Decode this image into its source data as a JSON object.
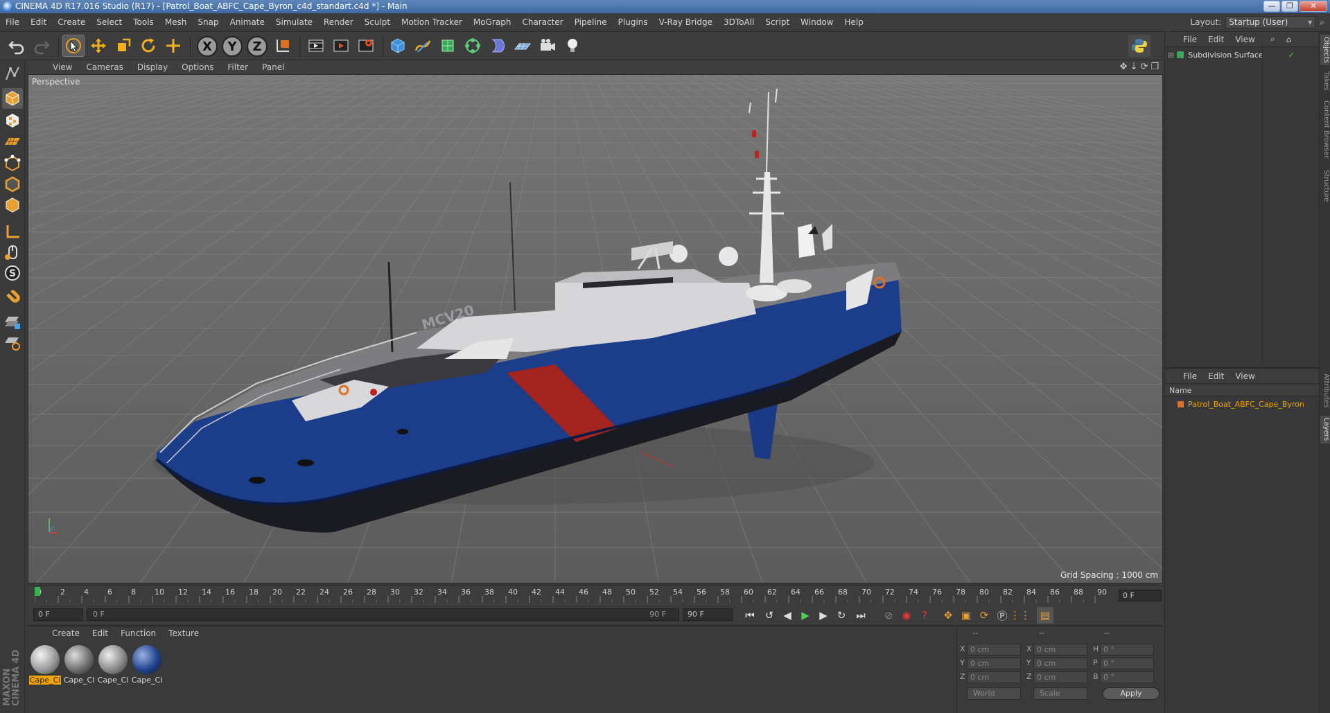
{
  "window": {
    "title": "CINEMA 4D R17.016 Studio (R17) - [Patrol_Boat_ABFC_Cape_Byron_c4d_standart.c4d *] - Main",
    "controls": [
      "—",
      "❐",
      "✕"
    ]
  },
  "menubar": {
    "items": [
      "File",
      "Edit",
      "Create",
      "Select",
      "Tools",
      "Mesh",
      "Snap",
      "Animate",
      "Simulate",
      "Render",
      "Sculpt",
      "Motion Tracker",
      "MoGraph",
      "Character",
      "Pipeline",
      "Plugins",
      "V-Ray Bridge",
      "3DToAll",
      "Script",
      "Window",
      "Help"
    ],
    "layout_label": "Layout:",
    "layout_value": "Startup (User)"
  },
  "toolbar": {
    "axis_x": "X",
    "axis_y": "Y",
    "axis_z": "Z"
  },
  "viewport": {
    "menu": [
      "View",
      "Cameras",
      "Display",
      "Options",
      "Filter",
      "Panel"
    ],
    "label": "Perspective",
    "grid_spacing": "Grid Spacing : 1000 cm",
    "hull_text": "MCV20"
  },
  "timeline": {
    "ticks": [
      "0",
      "2",
      "4",
      "6",
      "8",
      "10",
      "12",
      "14",
      "16",
      "18",
      "20",
      "22",
      "24",
      "26",
      "28",
      "30",
      "32",
      "34",
      "36",
      "38",
      "40",
      "42",
      "44",
      "46",
      "48",
      "50",
      "52",
      "54",
      "56",
      "58",
      "60",
      "62",
      "64",
      "66",
      "68",
      "70",
      "72",
      "74",
      "76",
      "78",
      "80",
      "82",
      "84",
      "86",
      "88",
      "90"
    ],
    "current_frame": "0 F",
    "start_field": "0 F",
    "range_start": "0 F",
    "range_end": "90 F",
    "end_field": "90 F"
  },
  "materials": {
    "menu": [
      "Create",
      "Edit",
      "Function",
      "Texture"
    ],
    "items": [
      {
        "label": "Cape_Cl",
        "active": true
      },
      {
        "label": "Cape_Cl",
        "active": false
      },
      {
        "label": "Cape_Cl",
        "active": false
      },
      {
        "label": "Cape_Cl",
        "active": false
      }
    ]
  },
  "coordinates": {
    "headers": [
      "--",
      "--",
      "--"
    ],
    "rows": [
      {
        "a": "X",
        "av": "0 cm",
        "b": "X",
        "bv": "0 cm",
        "c": "H",
        "cv": "0 °"
      },
      {
        "a": "Y",
        "av": "0 cm",
        "b": "Y",
        "bv": "0 cm",
        "c": "P",
        "cv": "0 °"
      },
      {
        "a": "Z",
        "av": "0 cm",
        "b": "Z",
        "bv": "0 cm",
        "c": "B",
        "cv": "0 °"
      }
    ],
    "mode_world": "World",
    "mode_scale": "Scale",
    "apply": "Apply"
  },
  "objects_panel": {
    "menu": [
      "File",
      "Edit",
      "View"
    ],
    "item": "Subdivision Surface"
  },
  "layers_panel": {
    "menu": [
      "File",
      "Edit",
      "View"
    ],
    "column": "Name",
    "item": "Patrol_Boat_ABFC_Cape_Byron"
  },
  "side_tabs": [
    "Objects",
    "Takes",
    "Content Browser",
    "Structure",
    "Attributes",
    "Layers"
  ],
  "brand": "MAXON CINEMA 4D",
  "colors": {
    "accent_orange": "#f3a500",
    "hull_blue": "#1b3d8a",
    "stripe_red": "#a3241e",
    "title_blue": "#4f79b0"
  }
}
